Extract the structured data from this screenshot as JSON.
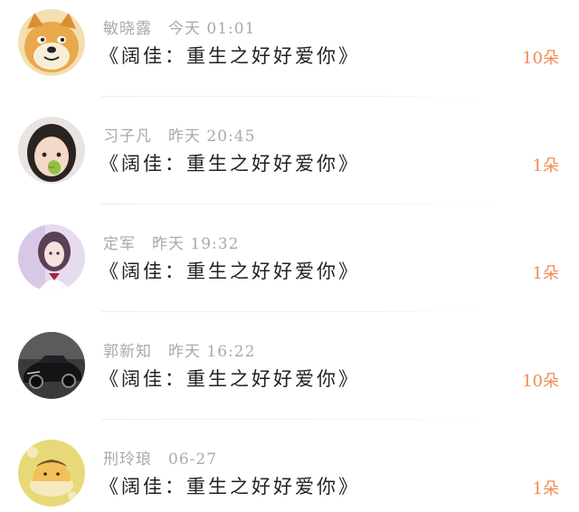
{
  "comments": [
    {
      "username": "敏晓露",
      "time": "今天 01:01",
      "title": "《阔佳：重生之好好爱你》",
      "count": "10朵",
      "avatar_icon": "doge-avatar"
    },
    {
      "username": "习子凡",
      "time": "昨天 20:45",
      "title": "《阔佳：重生之好好爱你》",
      "count": "1朵",
      "avatar_icon": "child-photo-avatar"
    },
    {
      "username": "定军",
      "time": "昨天 19:32",
      "title": "《阔佳：重生之好好爱你》",
      "count": "1朵",
      "avatar_icon": "girl-photo-avatar"
    },
    {
      "username": "郭新知",
      "time": "昨天 16:22",
      "title": "《阔佳：重生之好好爱你》",
      "count": "10朵",
      "avatar_icon": "car-photo-avatar"
    },
    {
      "username": "刑玲琅",
      "time": "06-27",
      "title": "《阔佳：重生之好好爱你》",
      "count": "1朵",
      "avatar_icon": "cartoon-pudding-avatar"
    }
  ],
  "colors": {
    "count": "#f08a52",
    "meta": "#a9a9a9",
    "title": "#222222"
  }
}
